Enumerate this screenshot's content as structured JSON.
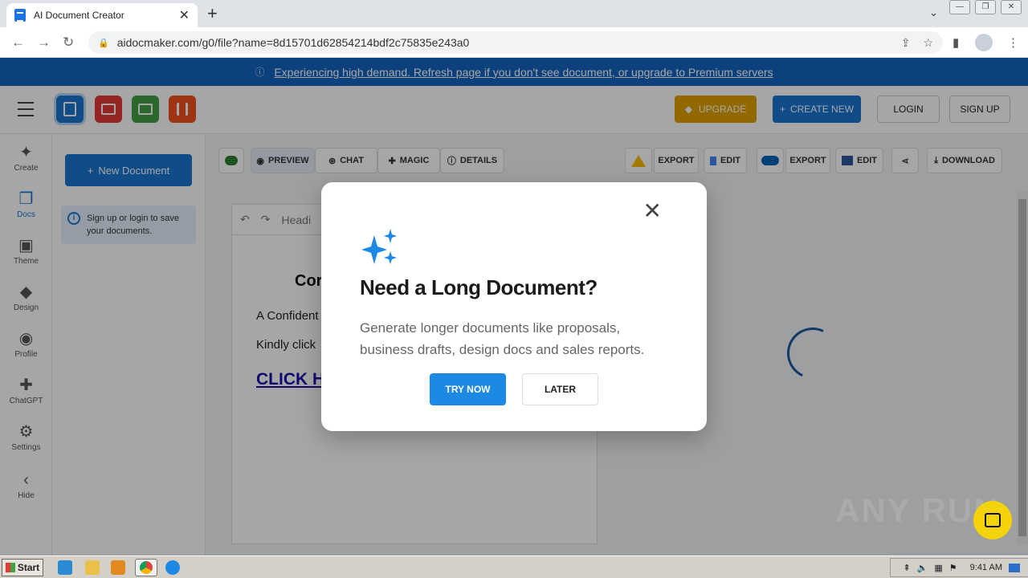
{
  "browser": {
    "tab_title": "AI Document Creator",
    "url": "aidocmaker.com/g0/file?name=8d15701d62854214bdf2c75835e243a0"
  },
  "banner": {
    "message": "Experiencing high demand. Refresh page if you don't see document, or upgrade to Premium servers"
  },
  "header": {
    "upgrade_label": "UPGRADE",
    "create_label": "CREATE NEW",
    "login_label": "LOGIN",
    "signup_label": "SIGN UP"
  },
  "rail": {
    "items": [
      {
        "label": "Create",
        "icon": "sparkle-icon"
      },
      {
        "label": "Docs",
        "icon": "docs-icon"
      },
      {
        "label": "Theme",
        "icon": "image-icon"
      },
      {
        "label": "Design",
        "icon": "design-icon"
      },
      {
        "label": "Profile",
        "icon": "profile-icon"
      },
      {
        "label": "ChatGPT",
        "icon": "chatgpt-icon"
      },
      {
        "label": "Settings",
        "icon": "gear-icon"
      },
      {
        "label": "Hide",
        "icon": "chevron-left-icon"
      }
    ]
  },
  "sidebar": {
    "new_doc_label": "New Document",
    "info_text": "Sign up or login to save your documents."
  },
  "toolbar": {
    "preview": "PREVIEW",
    "chat": "CHAT",
    "magic": "MAGIC",
    "details": "DETAILS",
    "export1": "EXPORT",
    "edit1": "EDIT",
    "export2": "EXPORT",
    "edit2": "EDIT",
    "download": "DOWNLOAD"
  },
  "document": {
    "format_label": "Headi",
    "title": "Cor",
    "line1": "A Confident",
    "line2": "Kindly click",
    "link": "CLICK H"
  },
  "modal": {
    "title": "Need a Long Document?",
    "body": "Generate longer documents like proposals, business drafts, design docs and sales reports.",
    "try_label": "TRY NOW",
    "later_label": "LATER"
  },
  "watermark": "ANY RUN",
  "taskbar": {
    "start_label": "Start",
    "time": "9:41 AM"
  },
  "colors": {
    "primary": "#1976d2",
    "banner": "#1565c0",
    "upgrade": "#e0a100",
    "chat_bubble": "#f5d30a"
  }
}
